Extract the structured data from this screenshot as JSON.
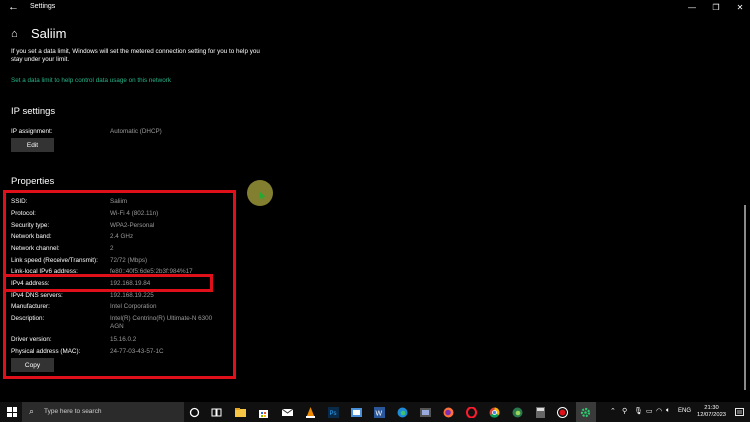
{
  "window": {
    "title": "Settings",
    "back_glyph": "←",
    "minimize_glyph": "—",
    "maximize_glyph": "❐",
    "close_glyph": "✕"
  },
  "page": {
    "home_icon": "home-icon",
    "title": "Saliim",
    "intro_text": "If you set a data limit, Windows will set the metered connection setting for you to help you stay under your limit.",
    "data_limit_link": "Set a data limit to help control data usage on this network"
  },
  "ip_settings": {
    "heading": "IP settings",
    "assignment_label": "IP assignment:",
    "assignment_value": "Automatic (DHCP)",
    "edit_label": "Edit"
  },
  "properties": {
    "heading": "Properties",
    "rows": [
      {
        "label": "SSID:",
        "value": "Saliim"
      },
      {
        "label": "Protocol:",
        "value": "Wi-Fi 4 (802.11n)"
      },
      {
        "label": "Security type:",
        "value": "WPA2-Personal"
      },
      {
        "label": "Network band:",
        "value": "2.4 GHz"
      },
      {
        "label": "Network channel:",
        "value": "2"
      },
      {
        "label": "Link speed (Receive/Transmit):",
        "value": "72/72 (Mbps)"
      },
      {
        "label": "Link-local IPv6 address:",
        "value": "fe80::40f5:6de5:2b3f:984%17"
      },
      {
        "label": "IPv4 address:",
        "value": "192.168.19.84"
      },
      {
        "label": "IPv4 DNS servers:",
        "value": "192.168.19.225"
      },
      {
        "label": "Manufacturer:",
        "value": "Intel Corporation"
      },
      {
        "label": "Description:",
        "value_line1": "Intel(R) Centrino(R) Ultimate-N 6300",
        "value_line2": "AGN"
      },
      {
        "label": "Driver version:",
        "value": "15.16.0.2"
      },
      {
        "label": "Physical address (MAC):",
        "value": "24-77-03-43-57-1C"
      }
    ],
    "copy_label": "Copy"
  },
  "highlight_color": "#e0101a",
  "link_color": "#26b387",
  "taskbar": {
    "search_placeholder": "Type here to search",
    "language": "ENG",
    "time": "21:30",
    "date": "12/07/2023",
    "pinned_icons": [
      "cortana-icon",
      "task-view-icon",
      "file-explorer-icon",
      "store-icon",
      "mail-icon",
      "vlc-icon",
      "photoshop-icon",
      "paint-icon",
      "word-icon",
      "edge-icon",
      "snipping-icon",
      "firefox-icon",
      "opera-icon",
      "chrome-icon",
      "edge-dev-icon",
      "calculator-icon",
      "record-icon",
      "settings-icon"
    ]
  }
}
